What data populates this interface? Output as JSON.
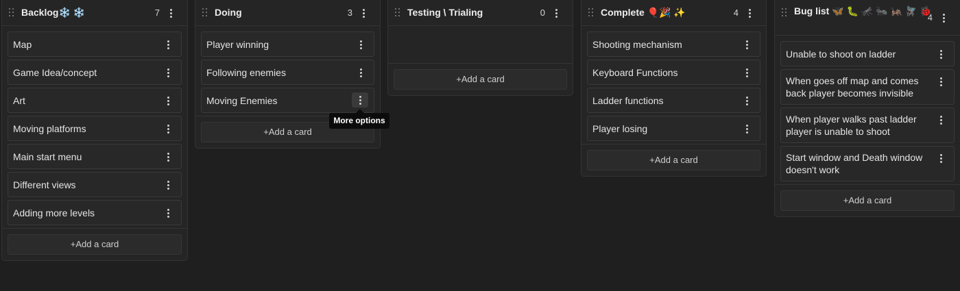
{
  "columns": [
    {
      "title": "Backlog❄️ ❄️",
      "count": "7",
      "cards": [
        "Map",
        "Game Idea/concept",
        "Art",
        "Moving platforms",
        "Main start menu",
        "Different views",
        "Adding more levels"
      ],
      "add_label": "+Add a card"
    },
    {
      "title": "Doing",
      "count": "3",
      "cards": [
        "Player winning",
        "Following enemies",
        "Moving Enemies"
      ],
      "add_label": "+Add a card"
    },
    {
      "title": "Testing \\ Trialing",
      "count": "0",
      "cards": [],
      "add_label": "+Add a card"
    },
    {
      "title": "Complete 🎈🎉 ✨",
      "count": "4",
      "cards": [
        "Shooting mechanism",
        "Keyboard Functions",
        "Ladder functions",
        "Player losing"
      ],
      "add_label": "+Add a card"
    },
    {
      "title": "Bug list 🦋 🐛 🦟 🐜 🦗 🪰 🐞",
      "count": "4",
      "cards": [
        "Unable to shoot on ladder",
        "When goes off map and comes back player becomes invisible",
        "When player walks past ladder player is unable to shoot",
        "Start window and Death window doesn't work"
      ],
      "add_label": "+Add a card"
    }
  ],
  "tooltip": {
    "text": "More options"
  }
}
